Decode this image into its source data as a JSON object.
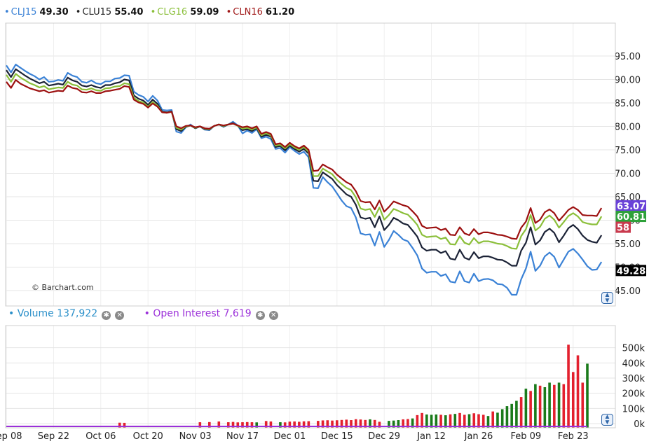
{
  "legend": [
    {
      "symbol": "CLJ15",
      "value": "49.30",
      "color": "#3b82d6"
    },
    {
      "symbol": "CLU15",
      "value": "55.40",
      "color": "#222222"
    },
    {
      "symbol": "CLG16",
      "value": "59.09",
      "color": "#8bbf3a"
    },
    {
      "symbol": "CLN16",
      "value": "61.20",
      "color": "#a01818"
    }
  ],
  "watermark": "© Barchart.com",
  "price_badges": [
    {
      "text": "63.07",
      "bg": "#6a42d8",
      "value": 63.07
    },
    {
      "text": "60.81",
      "bg": "#2ea13a",
      "value": 60.81
    },
    {
      "text": "58",
      "bg": "#c9394d",
      "value": 58.5
    },
    {
      "text": "49.28",
      "bg": "#000000",
      "value": 49.28
    }
  ],
  "volume_legend": {
    "label": "Volume",
    "value": "137,922",
    "color": "#2a8fc9"
  },
  "oi_legend": {
    "label": "Open Interest",
    "value": "7,619",
    "color": "#9b30d9"
  },
  "icons": {
    "settings": "gear-icon",
    "close": "close-icon",
    "scroll": "scroll-updown-icon"
  },
  "chart_data": [
    {
      "type": "line",
      "x": [
        "Sep 08",
        "Sep 22",
        "Oct 06",
        "Oct 20",
        "Nov 03",
        "Nov 17",
        "Dec 01",
        "Dec 15",
        "Dec 29",
        "Jan 12",
        "Jan 26",
        "Feb 09",
        "Feb 23"
      ],
      "x_index": [
        0,
        10,
        20,
        30,
        40,
        50,
        60,
        70,
        80,
        90,
        100,
        110,
        120
      ],
      "yticks": [
        "95.00",
        "90.00",
        "85.00",
        "80.00",
        "75.00",
        "70.00",
        "65.00",
        "60.00",
        "55.00",
        "50.00",
        "45.00"
      ],
      "ylim": [
        43,
        101
      ],
      "grid": true,
      "series": [
        {
          "name": "CLJ15",
          "color": "#3b82d6",
          "values": [
            93,
            91.5,
            93.2,
            92.5,
            91.8,
            91.2,
            90.7,
            90,
            90.5,
            89.5,
            89.6,
            89.9,
            89.7,
            91.4,
            90.8,
            90.5,
            89.5,
            89.3,
            89.8,
            89.2,
            89,
            89.6,
            89.6,
            90.2,
            90.3,
            90.9,
            90.8,
            87.4,
            86.7,
            86.3,
            85.3,
            86.5,
            85.5,
            83.5,
            83.4,
            83.5,
            78.9,
            78.6,
            79.8,
            80.4,
            79.6,
            80,
            79.3,
            79.2,
            80.1,
            80.4,
            79.9,
            80.4,
            81,
            80.2,
            78.5,
            79.1,
            78.6,
            79.4,
            77.5,
            77.8,
            77.3,
            75.2,
            75.4,
            74.4,
            75.6,
            74.8,
            74.1,
            74.6,
            73.4,
            66.9,
            66.8,
            69.2,
            68.1,
            67.2,
            65.7,
            64.2,
            63,
            62.6,
            60.6,
            57.2,
            56.9,
            57,
            54.6,
            57.5,
            54.3,
            55.8,
            57.7,
            56.9,
            55.9,
            55.5,
            54.1,
            52.5,
            49.7,
            48.8,
            49,
            49,
            48.1,
            48.5,
            46.9,
            46.7,
            49.1,
            47,
            46.7,
            48.6,
            47,
            47.4,
            47.5,
            47.2,
            46.4,
            46.3,
            45.6,
            44.1,
            44.1,
            47.4,
            49.7,
            53.3,
            49.2,
            50.3,
            52.3,
            53.1,
            52.2,
            49.9,
            51.6,
            53.3,
            53.9,
            52.9,
            51.6,
            50.2,
            49.4,
            49.5,
            51.1
          ]
        },
        {
          "name": "CLU15",
          "color": "#1b2236",
          "values": [
            92,
            90.5,
            92.2,
            91.5,
            90.8,
            90.2,
            89.7,
            89.2,
            89.5,
            88.7,
            88.9,
            89.1,
            88.9,
            90.4,
            89.8,
            89.5,
            88.7,
            88.5,
            88.8,
            88.4,
            88.2,
            88.8,
            88.8,
            89.2,
            89.4,
            90,
            89.8,
            86.6,
            85.9,
            85.5,
            84.6,
            85.7,
            84.8,
            83.1,
            83,
            83.2,
            79.4,
            79,
            79.9,
            80.2,
            79.6,
            80,
            79.4,
            79.3,
            80.1,
            80.4,
            80,
            80.4,
            80.7,
            80.1,
            79.2,
            79.4,
            79,
            79.6,
            77.8,
            78.2,
            77.8,
            75.6,
            75.8,
            74.9,
            75.9,
            75.2,
            74.6,
            75.2,
            74.2,
            68.4,
            68.3,
            70.2,
            69.5,
            68.8,
            67.5,
            66.5,
            65.5,
            65,
            63.3,
            60.6,
            60.3,
            60.5,
            58.5,
            60.8,
            57.9,
            59,
            60.5,
            60,
            59.3,
            59,
            57.8,
            56.5,
            54.2,
            53.5,
            53.7,
            53.7,
            53,
            53.4,
            51.8,
            51.6,
            53.7,
            52,
            51.6,
            53.2,
            51.9,
            52.3,
            52.3,
            52,
            51.6,
            51.5,
            51,
            50.3,
            50.3,
            53.5,
            55.2,
            58.5,
            54.8,
            55.7,
            57.5,
            58.2,
            57.3,
            55.3,
            56.7,
            58.3,
            59,
            58.1,
            56.7,
            55.8,
            55.4,
            55.2,
            56.8
          ]
        },
        {
          "name": "CLG16",
          "color": "#8bbf3a",
          "values": [
            91,
            89.5,
            91.2,
            90.4,
            89.8,
            89.2,
            88.8,
            88.3,
            88.6,
            87.9,
            88.1,
            88.3,
            88.2,
            89.5,
            88.9,
            88.7,
            87.9,
            87.8,
            88.1,
            87.7,
            87.6,
            88.1,
            88.2,
            88.5,
            88.6,
            89.2,
            89,
            86.1,
            85.4,
            85.1,
            84.2,
            85.2,
            84.4,
            83,
            82.9,
            83.1,
            79.7,
            79.3,
            80,
            80.2,
            79.7,
            80,
            79.5,
            79.4,
            80.1,
            80.4,
            80.1,
            80.4,
            80.6,
            80.1,
            79.5,
            79.7,
            79.3,
            79.8,
            78.1,
            78.5,
            78.1,
            75.9,
            76.1,
            75.3,
            76.2,
            75.5,
            75,
            75.6,
            74.6,
            69.4,
            69.4,
            71,
            70.4,
            69.8,
            68.6,
            67.7,
            66.9,
            66.4,
            64.9,
            62.5,
            62.2,
            62.4,
            60.7,
            62.7,
            60.1,
            61.1,
            62.4,
            62,
            61.5,
            61.2,
            60.2,
            59,
            56.9,
            56.4,
            56.5,
            56.6,
            56,
            56.3,
            54.9,
            54.8,
            56.6,
            55.2,
            54.8,
            56.2,
            55.1,
            55.5,
            55.5,
            55.3,
            55,
            54.9,
            54.5,
            54,
            53.9,
            56.6,
            58.1,
            61.1,
            57.8,
            58.6,
            60.3,
            61,
            60.1,
            58.4,
            59.6,
            60.9,
            61.5,
            60.8,
            59.6,
            59.3,
            59.1,
            59.1,
            60.8
          ]
        },
        {
          "name": "CLN16",
          "color": "#9c1010",
          "values": [
            89.5,
            88.2,
            89.9,
            89.1,
            88.6,
            88.1,
            87.8,
            87.5,
            87.7,
            87.2,
            87.4,
            87.6,
            87.5,
            88.7,
            88.2,
            88,
            87.3,
            87.2,
            87.5,
            87.1,
            87.1,
            87.5,
            87.6,
            87.8,
            88,
            88.6,
            88.4,
            85.7,
            85.1,
            84.8,
            84,
            84.9,
            84.2,
            83,
            82.9,
            83.1,
            80,
            79.6,
            80.1,
            80.2,
            79.8,
            80,
            79.6,
            79.5,
            80.1,
            80.4,
            80.2,
            80.4,
            80.6,
            80.2,
            79.8,
            80,
            79.6,
            80,
            78.4,
            78.8,
            78.4,
            76.2,
            76.4,
            75.6,
            76.5,
            75.8,
            75.3,
            75.9,
            75,
            70.5,
            70.6,
            71.9,
            71.3,
            70.8,
            69.7,
            68.9,
            68.1,
            67.6,
            66.2,
            64.1,
            63.8,
            63.9,
            62.3,
            64.2,
            61.8,
            62.8,
            64,
            63.6,
            63.2,
            62.9,
            61.9,
            60.8,
            58.8,
            58.3,
            58.4,
            58.5,
            57.9,
            58.2,
            56.9,
            56.8,
            58.5,
            57.2,
            56.8,
            58.1,
            57,
            57.4,
            57.4,
            57.2,
            56.9,
            56.8,
            56.5,
            56.1,
            56,
            58.4,
            59.7,
            62.6,
            59.4,
            60.1,
            61.7,
            62.3,
            61.5,
            59.9,
            61,
            62.2,
            62.8,
            62.2,
            61.1,
            61,
            61,
            60.9,
            62.6
          ]
        }
      ]
    },
    {
      "type": "bar",
      "title": "Volume",
      "x_index_start": 0,
      "yticks": [
        "500k",
        "400k",
        "300k",
        "200k",
        "100k",
        "0k"
      ],
      "ylim": [
        0,
        560000
      ],
      "colors": {
        "up": "#1a7a1a",
        "down": "#e3202e"
      },
      "bars": [
        {
          "i": 24,
          "v": 6000,
          "d": "down"
        },
        {
          "i": 25,
          "v": 5000,
          "d": "down"
        },
        {
          "i": 41,
          "v": 9000,
          "d": "down"
        },
        {
          "i": 43,
          "v": 10000,
          "d": "down"
        },
        {
          "i": 45,
          "v": 14000,
          "d": "down"
        },
        {
          "i": 47,
          "v": 9000,
          "d": "down"
        },
        {
          "i": 48,
          "v": 11000,
          "d": "down"
        },
        {
          "i": 49,
          "v": 8000,
          "d": "down"
        },
        {
          "i": 50,
          "v": 9000,
          "d": "down"
        },
        {
          "i": 51,
          "v": 10000,
          "d": "down"
        },
        {
          "i": 52,
          "v": 9000,
          "d": "down"
        },
        {
          "i": 53,
          "v": 8000,
          "d": "up"
        },
        {
          "i": 55,
          "v": 17000,
          "d": "down"
        },
        {
          "i": 56,
          "v": 14000,
          "d": "down"
        },
        {
          "i": 58,
          "v": 9000,
          "d": "up"
        },
        {
          "i": 59,
          "v": 8000,
          "d": "down"
        },
        {
          "i": 60,
          "v": 13000,
          "d": "down"
        },
        {
          "i": 61,
          "v": 14000,
          "d": "down"
        },
        {
          "i": 62,
          "v": 12000,
          "d": "down"
        },
        {
          "i": 63,
          "v": 15000,
          "d": "down"
        },
        {
          "i": 64,
          "v": 16000,
          "d": "down"
        },
        {
          "i": 66,
          "v": 18000,
          "d": "down"
        },
        {
          "i": 67,
          "v": 21000,
          "d": "down"
        },
        {
          "i": 68,
          "v": 22000,
          "d": "down"
        },
        {
          "i": 69,
          "v": 20000,
          "d": "down"
        },
        {
          "i": 70,
          "v": 22000,
          "d": "down"
        },
        {
          "i": 71,
          "v": 24000,
          "d": "down"
        },
        {
          "i": 72,
          "v": 26000,
          "d": "down"
        },
        {
          "i": 73,
          "v": 23000,
          "d": "down"
        },
        {
          "i": 74,
          "v": 29000,
          "d": "down"
        },
        {
          "i": 75,
          "v": 27000,
          "d": "down"
        },
        {
          "i": 76,
          "v": 24000,
          "d": "down"
        },
        {
          "i": 77,
          "v": 28000,
          "d": "up"
        },
        {
          "i": 78,
          "v": 24000,
          "d": "down"
        },
        {
          "i": 79,
          "v": 12000,
          "d": "down"
        },
        {
          "i": 81,
          "v": 18000,
          "d": "up"
        },
        {
          "i": 82,
          "v": 20000,
          "d": "up"
        },
        {
          "i": 83,
          "v": 23000,
          "d": "up"
        },
        {
          "i": 84,
          "v": 28000,
          "d": "down"
        },
        {
          "i": 85,
          "v": 30000,
          "d": "down"
        },
        {
          "i": 86,
          "v": 34000,
          "d": "up"
        },
        {
          "i": 87,
          "v": 56000,
          "d": "down"
        },
        {
          "i": 88,
          "v": 70000,
          "d": "down"
        },
        {
          "i": 89,
          "v": 60000,
          "d": "up"
        },
        {
          "i": 90,
          "v": 58000,
          "d": "up"
        },
        {
          "i": 91,
          "v": 60000,
          "d": "up"
        },
        {
          "i": 92,
          "v": 58000,
          "d": "down"
        },
        {
          "i": 93,
          "v": 55000,
          "d": "up"
        },
        {
          "i": 94,
          "v": 61000,
          "d": "down"
        },
        {
          "i": 95,
          "v": 64000,
          "d": "up"
        },
        {
          "i": 96,
          "v": 70000,
          "d": "down"
        },
        {
          "i": 97,
          "v": 58000,
          "d": "down"
        },
        {
          "i": 98,
          "v": 62000,
          "d": "up"
        },
        {
          "i": 99,
          "v": 68000,
          "d": "down"
        },
        {
          "i": 100,
          "v": 62000,
          "d": "down"
        },
        {
          "i": 101,
          "v": 58000,
          "d": "down"
        },
        {
          "i": 102,
          "v": 50000,
          "d": "up"
        },
        {
          "i": 103,
          "v": 80000,
          "d": "down"
        },
        {
          "i": 104,
          "v": 72000,
          "d": "up"
        },
        {
          "i": 105,
          "v": 95000,
          "d": "up"
        },
        {
          "i": 106,
          "v": 115000,
          "d": "up"
        },
        {
          "i": 107,
          "v": 130000,
          "d": "up"
        },
        {
          "i": 108,
          "v": 150000,
          "d": "up"
        },
        {
          "i": 109,
          "v": 175000,
          "d": "down"
        },
        {
          "i": 110,
          "v": 230000,
          "d": "up"
        },
        {
          "i": 111,
          "v": 215000,
          "d": "down"
        },
        {
          "i": 112,
          "v": 260000,
          "d": "up"
        },
        {
          "i": 113,
          "v": 250000,
          "d": "down"
        },
        {
          "i": 114,
          "v": 240000,
          "d": "up"
        },
        {
          "i": 115,
          "v": 270000,
          "d": "up"
        },
        {
          "i": 116,
          "v": 255000,
          "d": "down"
        },
        {
          "i": 117,
          "v": 270000,
          "d": "up"
        },
        {
          "i": 118,
          "v": 260000,
          "d": "down"
        },
        {
          "i": 119,
          "v": 520000,
          "d": "down"
        },
        {
          "i": 120,
          "v": 340000,
          "d": "down"
        },
        {
          "i": 121,
          "v": 450000,
          "d": "down"
        },
        {
          "i": 122,
          "v": 270000,
          "d": "down"
        },
        {
          "i": 123,
          "v": 395000,
          "d": "up"
        }
      ],
      "open_interest": 7619
    }
  ]
}
